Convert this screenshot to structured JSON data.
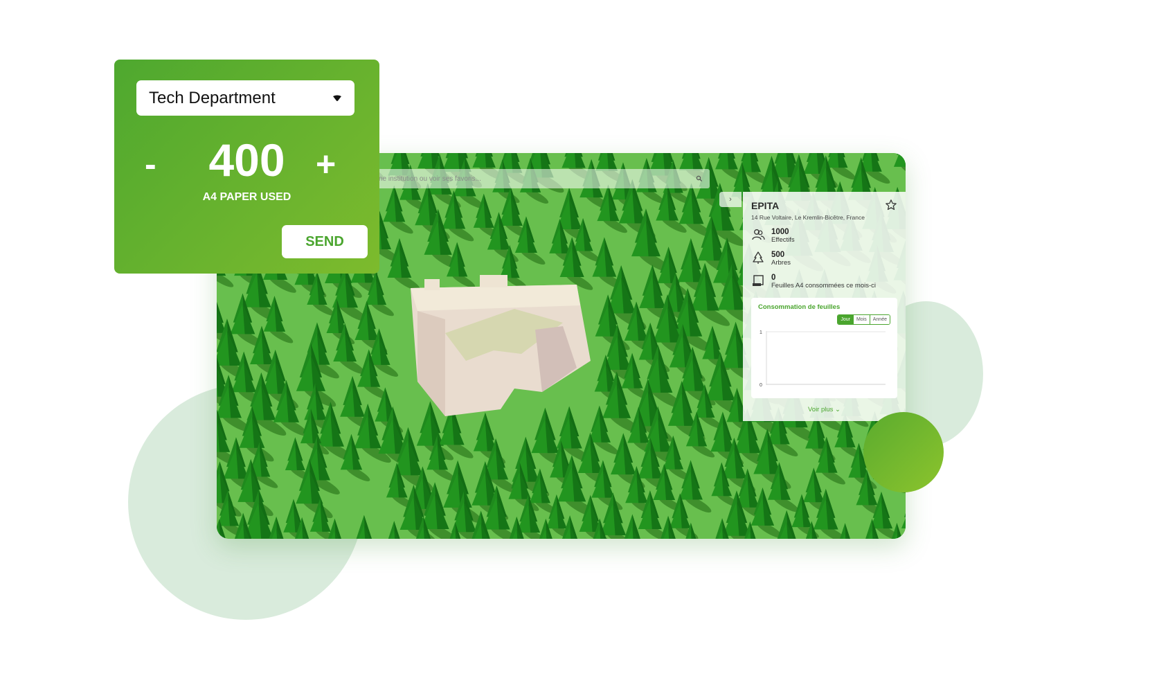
{
  "counter": {
    "department": "Tech Department",
    "minus_label": "-",
    "value": "400",
    "plus_label": "+",
    "unit_label": "A4 PAPER USED",
    "send_label": "SEND"
  },
  "search": {
    "placeholder": "ne institution ou voir ses favoris..."
  },
  "panel": {
    "collapse_glyph": "›",
    "title": "EPITA",
    "address": "14 Rue Voltaire, Le Kremlin-Bicêtre, France",
    "stats": [
      {
        "value": "1000",
        "label": "Effectifs",
        "icon": "people-icon"
      },
      {
        "value": "500",
        "label": "Arbres",
        "icon": "tree-icon"
      },
      {
        "value": "0",
        "label": "Feuilles A4 consommées ce mois-ci",
        "icon": "paper-icon"
      }
    ],
    "chart": {
      "title": "Consommation de feuilles",
      "periods": [
        "Jour",
        "Mois",
        "Année"
      ],
      "active_period": "Jour"
    },
    "more_label": "Voir plus ⌄"
  },
  "chart_data": {
    "type": "line",
    "title": "Consommation de feuilles",
    "series": [],
    "ylim": [
      0,
      1
    ],
    "yticks": [
      "1",
      "0"
    ]
  },
  "colors": {
    "brand_green": "#4aa52e",
    "card_gradient_start": "#4ea82f",
    "card_gradient_end": "#7dbb2d",
    "bubble": "#d9ebdc"
  }
}
